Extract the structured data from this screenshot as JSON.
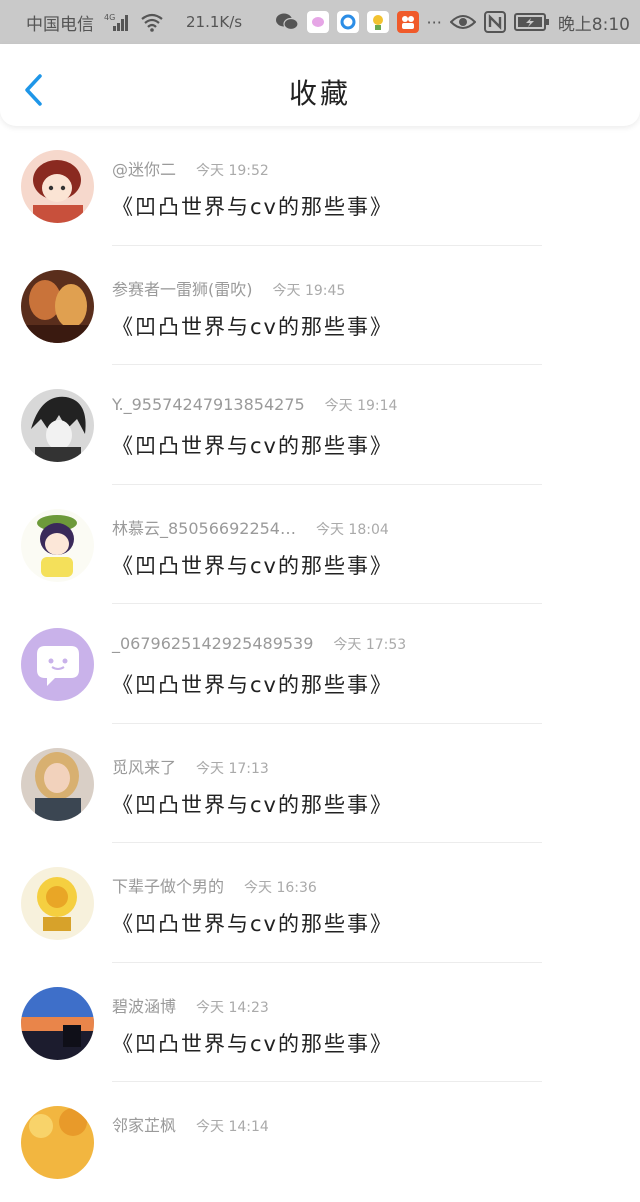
{
  "status_bar": {
    "carrier": "中国电信",
    "network": "4G",
    "speed": "21.1K/s",
    "time": "晚上8:10",
    "more": "···",
    "icons": [
      "signal-icon",
      "wifi-icon",
      "wechat-icon",
      "app-icon",
      "qq-browser-icon",
      "app-icon",
      "xiaohongshu-icon",
      "eye-icon",
      "nfc-icon",
      "battery-icon"
    ]
  },
  "header": {
    "title": "收藏",
    "back_icon": "chevron-left-icon",
    "accent": "#1e96e8"
  },
  "items": [
    {
      "name": "@迷你二",
      "time": "今天 19:52",
      "content": "《凹凸世界与cv的那些事》"
    },
    {
      "name": "参赛者一雷狮(雷吹)",
      "time": "今天 19:45",
      "content": "《凹凸世界与cv的那些事》"
    },
    {
      "name": "Y._95574247913854275",
      "time": "今天 19:14",
      "content": "《凹凸世界与cv的那些事》"
    },
    {
      "name": "林慕云_85056692254…",
      "time": "今天 18:04",
      "content": "《凹凸世界与cv的那些事》"
    },
    {
      "name": "_0679625142925489539",
      "time": "今天 17:53",
      "content": "《凹凸世界与cv的那些事》"
    },
    {
      "name": "觅风来了",
      "time": "今天 17:13",
      "content": "《凹凸世界与cv的那些事》"
    },
    {
      "name": "下辈子做个男的",
      "time": "今天 16:36",
      "content": "《凹凸世界与cv的那些事》"
    },
    {
      "name": "碧波涵博",
      "time": "今天 14:23",
      "content": "《凹凸世界与cv的那些事》"
    },
    {
      "name": "邻家芷枫",
      "time": "今天 14:14",
      "content": ""
    }
  ]
}
